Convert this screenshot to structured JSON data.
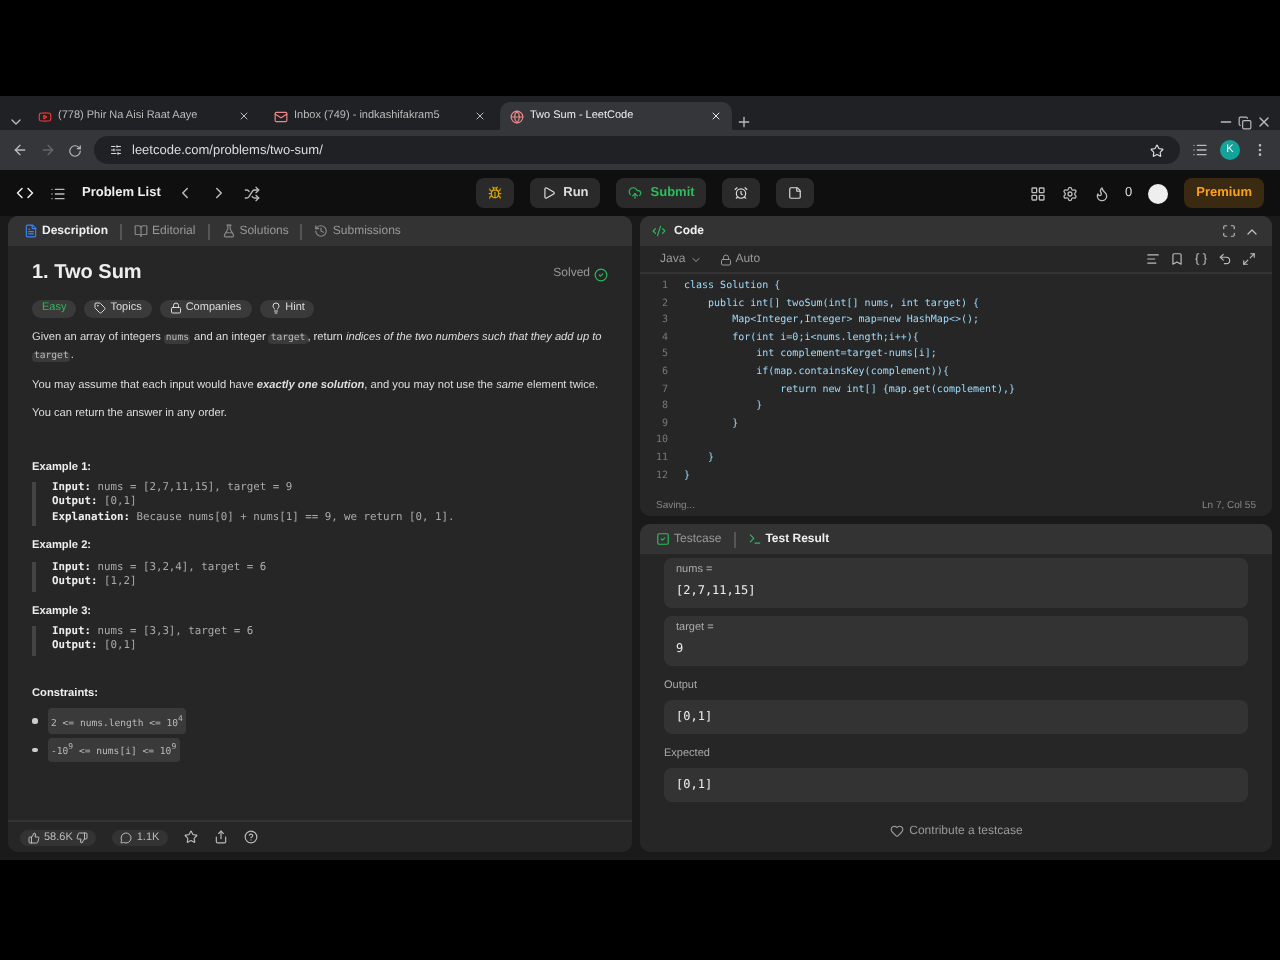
{
  "browser": {
    "tabs": [
      {
        "title": "(778) Phir Na Aisi Raat Aaye",
        "selected": false,
        "kind": "video"
      },
      {
        "title": "Inbox (749) - indkashifakram5",
        "selected": false,
        "kind": "mail"
      },
      {
        "title": "Two Sum - LeetCode",
        "selected": true,
        "kind": "site"
      }
    ],
    "url": "leetcode.com/problems/two-sum/",
    "profile_initial": "K"
  },
  "navbar": {
    "problem_list": "Problem List",
    "run": "Run",
    "submit": "Submit",
    "streak": "0",
    "premium": "Premium"
  },
  "description_panel": {
    "tabs": [
      {
        "label": "Description",
        "selected": true,
        "kind": "description"
      },
      {
        "label": "Editorial",
        "selected": false,
        "kind": "editorial"
      },
      {
        "label": "Solutions",
        "selected": false,
        "kind": "solutions"
      },
      {
        "label": "Submissions",
        "selected": false,
        "kind": "submissions"
      }
    ],
    "title": "1. Two Sum",
    "status": "Solved",
    "difficulty": "Easy",
    "tags": [
      {
        "label": "Topics",
        "kind": "tag"
      },
      {
        "label": "Companies",
        "kind": "lock"
      },
      {
        "label": "Hint",
        "kind": "bulb"
      }
    ],
    "paragraphs": [
      [
        {
          "text": "Given an array of integers ",
          "kind": "plain"
        },
        {
          "text": "nums",
          "kind": "code"
        },
        {
          "text": " and an integer ",
          "kind": "plain"
        },
        {
          "text": "target",
          "kind": "code"
        },
        {
          "text": ", return ",
          "kind": "plain"
        },
        {
          "text": "indices of the two numbers such that they add up to ",
          "kind": "italic"
        },
        {
          "text": "target",
          "kind": "code"
        },
        {
          "text": ".",
          "kind": "plain"
        }
      ],
      [
        {
          "text": "You may assume that each input would have ",
          "kind": "plain"
        },
        {
          "text": "exactly one solution",
          "kind": "bolditalic"
        },
        {
          "text": ", and you may not use the ",
          "kind": "plain"
        },
        {
          "text": "same",
          "kind": "italic"
        },
        {
          "text": " element twice.",
          "kind": "plain"
        }
      ],
      [
        {
          "text": "You can return the answer in any order.",
          "kind": "plain"
        }
      ]
    ],
    "examples": [
      {
        "heading": "Example 1:",
        "lines": [
          {
            "label": "Input:",
            "value": "nums = [2,7,11,15], target = 9"
          },
          {
            "label": "Output:",
            "value": "[0,1]"
          },
          {
            "label": "Explanation:",
            "value": "Because nums[0] + nums[1] == 9, we return [0, 1]."
          }
        ]
      },
      {
        "heading": "Example 2:",
        "lines": [
          {
            "label": "Input:",
            "value": "nums = [3,2,4], target = 6"
          },
          {
            "label": "Output:",
            "value": "[1,2]"
          }
        ]
      },
      {
        "heading": "Example 3:",
        "lines": [
          {
            "label": "Input:",
            "value": "nums = [3,3], target = 6"
          },
          {
            "label": "Output:",
            "value": "[0,1]"
          }
        ]
      }
    ],
    "constraints_heading": "Constraints:",
    "constraints": [
      "2 <= nums.length <= 10$^{4}$",
      "-10$^{9}$ <= nums[i] <= 10$^{9}$"
    ],
    "footer": {
      "likes": "58.6K",
      "comments": "1.1K"
    }
  },
  "code_panel": {
    "title": "Code",
    "language": "Java",
    "mode": "Auto",
    "lines": [
      {
        "number": "1",
        "text": "class Solution {"
      },
      {
        "number": "2",
        "text": "    public int[] twoSum(int[] nums, int target) {"
      },
      {
        "number": "3",
        "text": "        Map<Integer,Integer> map=new HashMap<>();"
      },
      {
        "number": "4",
        "text": "        for(int i=0;i<nums.length;i++){"
      },
      {
        "number": "5",
        "text": "            int complement=target-nums[i];"
      },
      {
        "number": "6",
        "text": "            if(map.containsKey(complement)){"
      },
      {
        "number": "7",
        "text": "                return new int[] {map.get(complement),}"
      },
      {
        "number": "8",
        "text": "            }"
      },
      {
        "number": "9",
        "text": "        }"
      },
      {
        "number": "10"
      },
      {
        "number": "11",
        "text": "    }"
      },
      {
        "number": "12",
        "text": "}"
      }
    ],
    "status": "Saving...",
    "cursor": "Ln 7, Col 55"
  },
  "test_panel": {
    "tabs": [
      {
        "label": "Testcase",
        "selected": false,
        "kind": "check"
      },
      {
        "label": "Test Result",
        "selected": true,
        "kind": "terminal"
      }
    ],
    "inputs": [
      {
        "label": "nums =",
        "value": "[2,7,11,15]"
      },
      {
        "label": "target =",
        "value": "9"
      }
    ],
    "results": [
      {
        "label": "Output",
        "value": "[0,1]"
      },
      {
        "label": "Expected",
        "value": "[0,1]"
      }
    ],
    "contribute": "Contribute a testcase"
  }
}
